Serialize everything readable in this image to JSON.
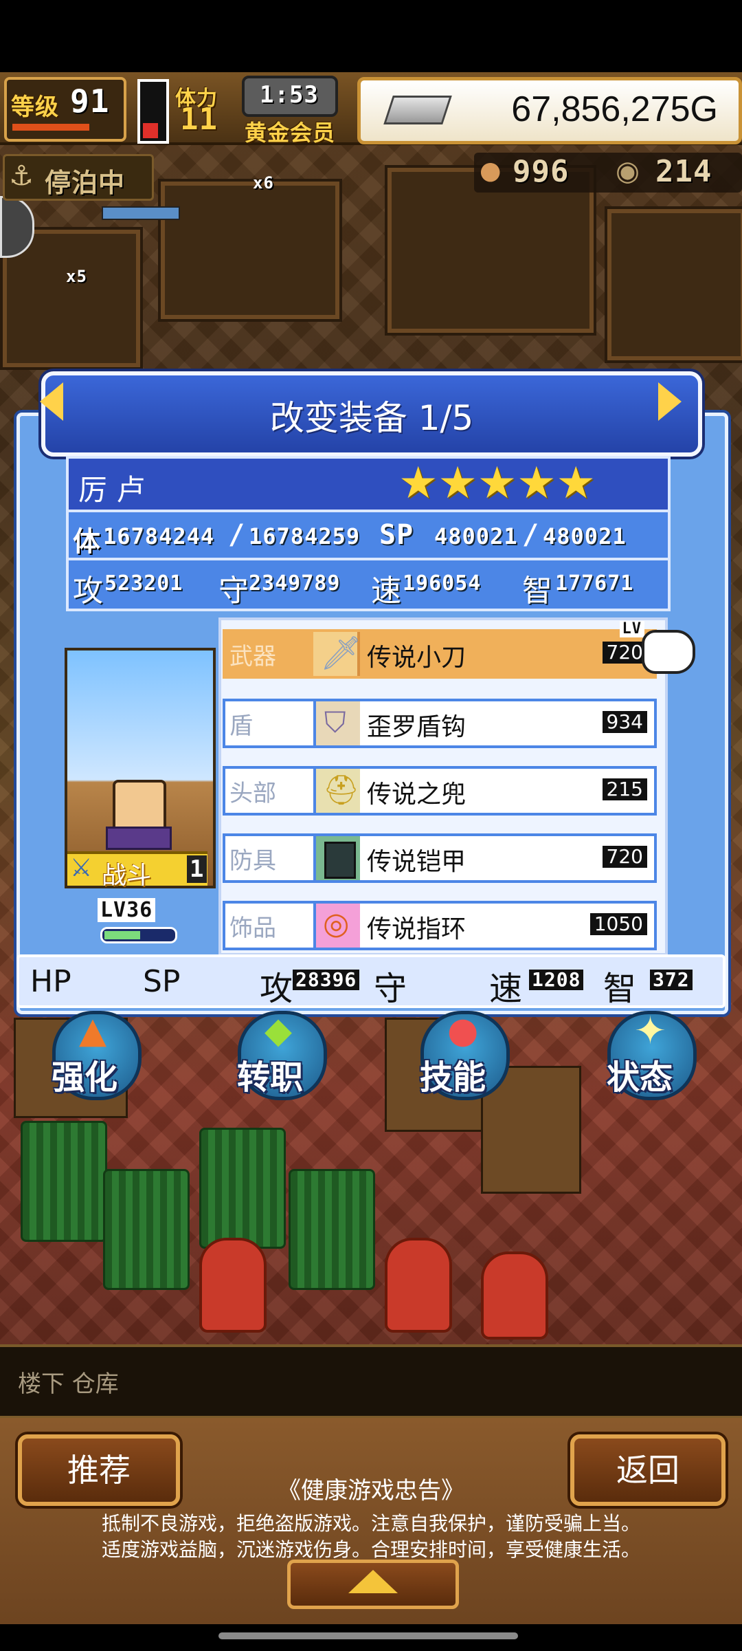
{
  "hud": {
    "level_label": "等级",
    "level_value": "91",
    "stamina_label": "体力",
    "stamina_value": "11",
    "timer": "1:53",
    "membership": "黄金会员",
    "money": "67,856,275G",
    "docked_status": "停泊中",
    "resource_a": "996",
    "resource_b": "214",
    "multiplier_a": "x6",
    "multiplier_b": "x5"
  },
  "panel": {
    "title": "改变装备 1/5",
    "character_name": "厉 卢",
    "stars": 5,
    "hp_label": "体",
    "hp_current": "16784244",
    "hp_max": "16784259",
    "sp_label": "SP",
    "sp_current": "480021",
    "sp_max": "480021",
    "atk_label": "攻",
    "atk_value": "523201",
    "def_label": "守",
    "def_value": "2349789",
    "spd_label": "速",
    "spd_value": "196054",
    "int_label": "智",
    "int_value": "177671",
    "job_label": "战斗",
    "job_num": "1",
    "char_level": "LV36",
    "equip_level_label": "LV",
    "equipment": [
      {
        "slot": "武器",
        "name": "传说小刀",
        "value": "720",
        "icon": "dagger-icon",
        "selected": true
      },
      {
        "slot": "盾",
        "name": "歪罗盾钩",
        "value": "934",
        "icon": "shield-claw-icon",
        "selected": false
      },
      {
        "slot": "头部",
        "name": "传说之兜",
        "value": "215",
        "icon": "helmet-icon",
        "selected": false
      },
      {
        "slot": "防具",
        "name": "传说铠甲",
        "value": "720",
        "icon": "armor-icon",
        "selected": false
      },
      {
        "slot": "饰品",
        "name": "传说指环",
        "value": "1050",
        "icon": "ring-icon",
        "selected": false
      }
    ],
    "bottom_stats": {
      "hp": "HP",
      "sp": "SP",
      "atk_label": "攻",
      "atk_value": "28396",
      "def_label": "守",
      "spd_label": "速",
      "spd_value": "1208",
      "int_label": "智",
      "int_value": "372"
    }
  },
  "actions": {
    "enhance": "强化",
    "job_change": "转职",
    "skill": "技能",
    "status": "状态"
  },
  "location": "楼下 仓库",
  "footer": {
    "recommend": "推荐",
    "back": "返回",
    "notice_title": "《健康游戏忠告》",
    "notice_line1": "抵制不良游戏，拒绝盗版游戏。注意自我保护，谨防受骗上当。",
    "notice_line2": "适度游戏益脑，沉迷游戏伤身。合理安排时间，享受健康生活。"
  },
  "colors": {
    "panel_blue": "#6aa3ea",
    "title_blue": "#2f4fbf",
    "selected_row": "#f0b05a",
    "gold": "#ffd24a",
    "star": "#ffd83a"
  }
}
